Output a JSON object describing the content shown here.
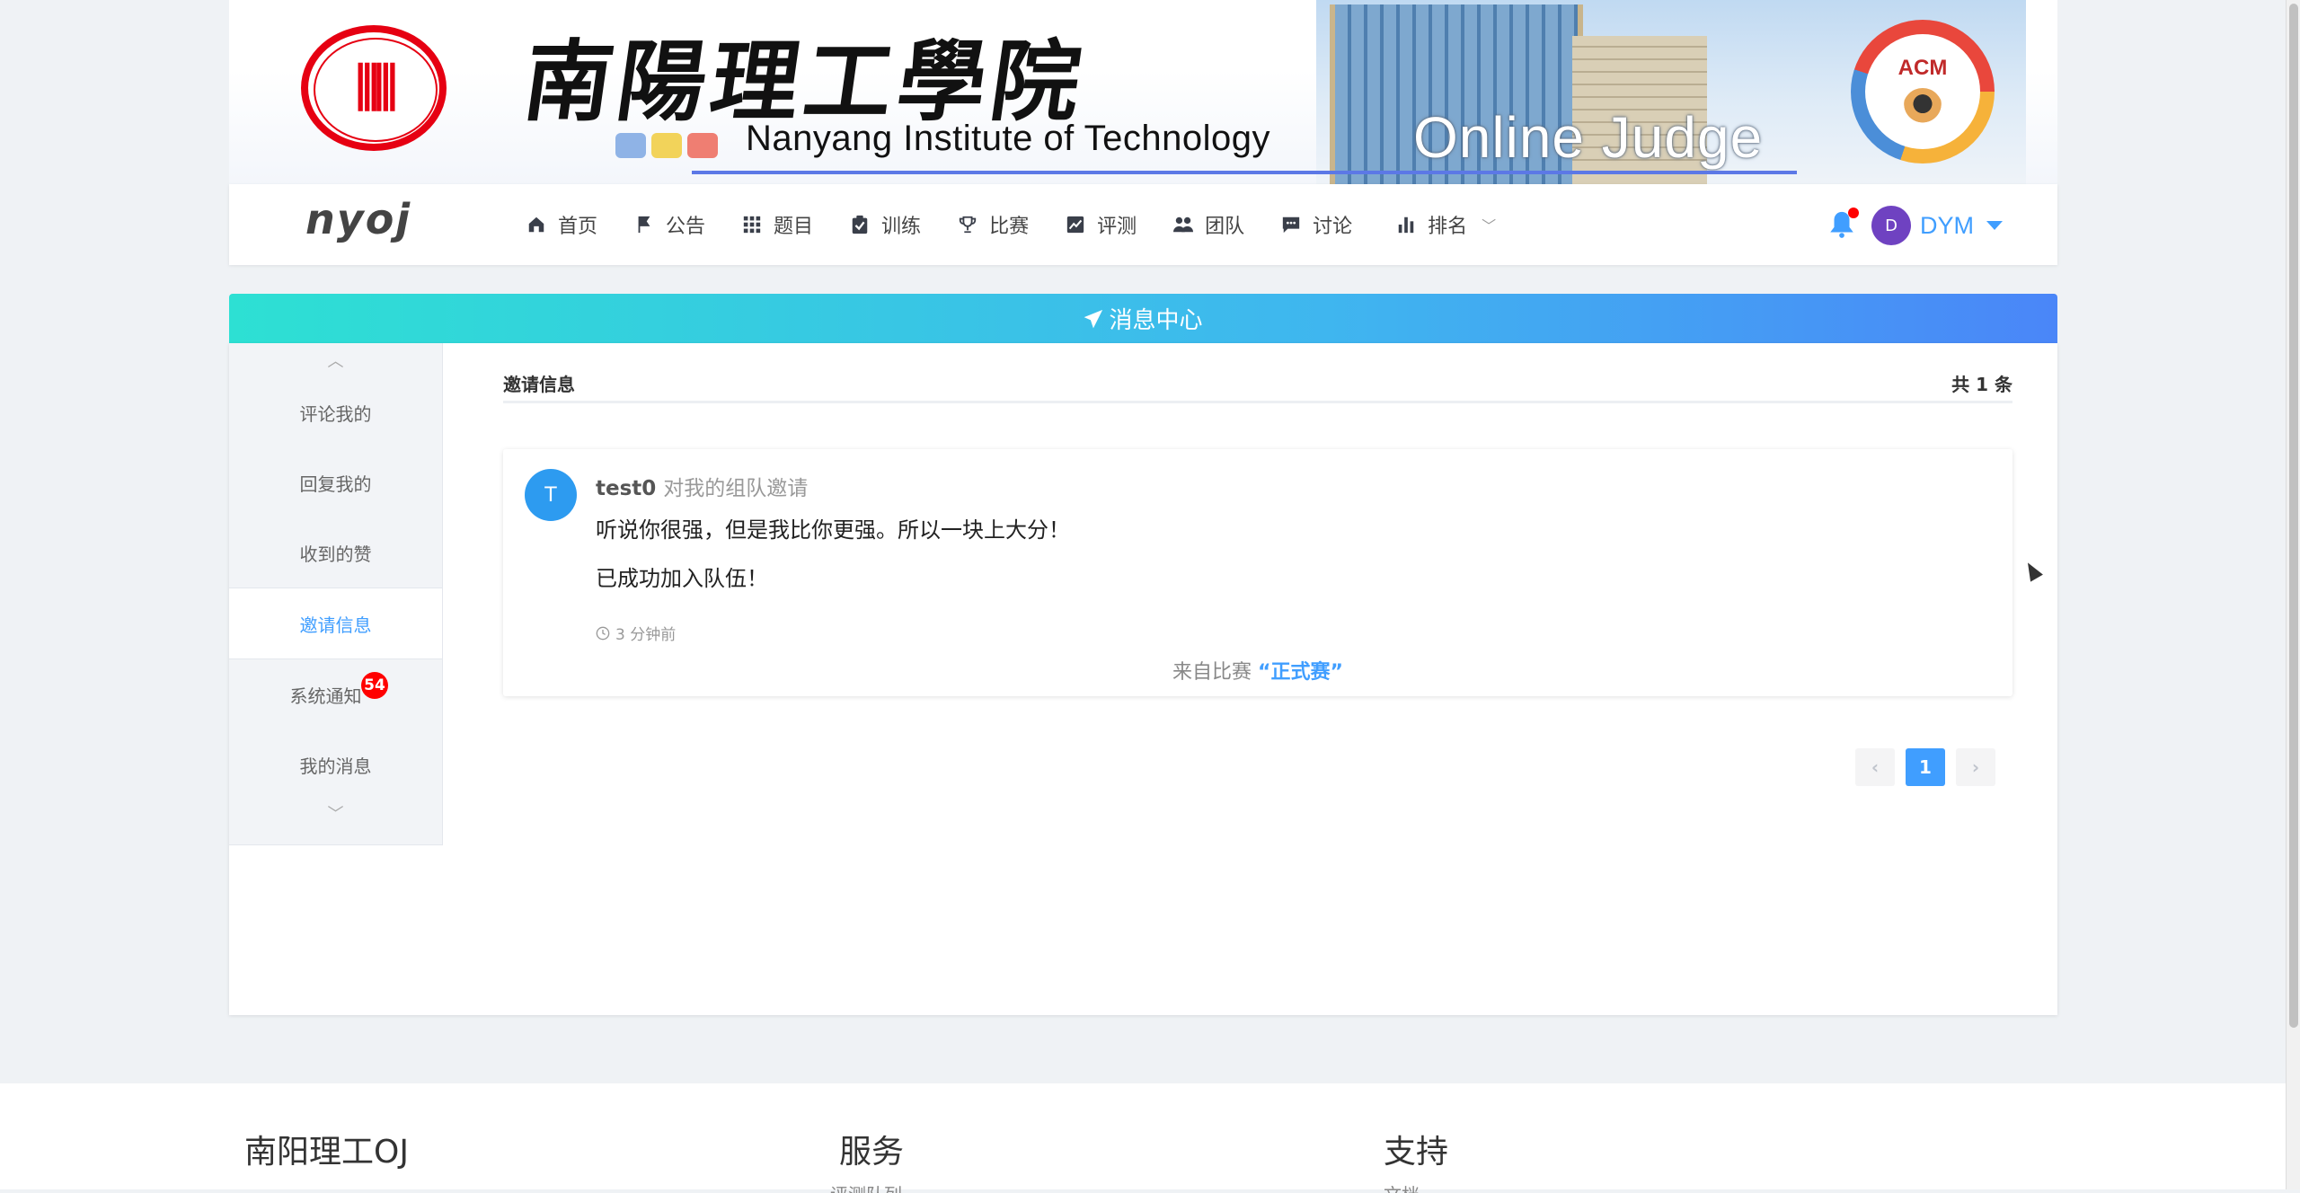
{
  "banner": {
    "school_cn": "南陽理工學院",
    "school_en": "Nanyang Institute of Technology",
    "product": "Online Judge",
    "acm_label": "ACM"
  },
  "nav": {
    "brand": "nyoj",
    "items": [
      {
        "label": "首页",
        "icon": "home-icon"
      },
      {
        "label": "公告",
        "icon": "flag-icon"
      },
      {
        "label": "题目",
        "icon": "grid-icon"
      },
      {
        "label": "训练",
        "icon": "clipboard-icon"
      },
      {
        "label": "比赛",
        "icon": "trophy-icon"
      },
      {
        "label": "评测",
        "icon": "chart-line-icon"
      },
      {
        "label": "团队",
        "icon": "users-icon"
      },
      {
        "label": "讨论",
        "icon": "comment-icon"
      },
      {
        "label": "排名",
        "icon": "bar-chart-icon"
      }
    ],
    "user_initial": "D",
    "username": "DYM"
  },
  "message_center": {
    "title": "消息中心",
    "sidebar": [
      {
        "label": "评论我的"
      },
      {
        "label": "回复我的"
      },
      {
        "label": "收到的赞"
      },
      {
        "label": "邀请信息",
        "active": true
      },
      {
        "label": "系统通知",
        "badge": "54"
      },
      {
        "label": "我的消息"
      }
    ],
    "section_title": "邀请信息",
    "total": "共 1 条",
    "message": {
      "avatar": "T",
      "sender": "test0",
      "action": "对我的组队邀请",
      "text": "听说你很强，但是我比你更强。所以一块上大分！",
      "status": "已成功加入队伍！",
      "time": "3 分钟前",
      "from_prefix": "来自比赛",
      "from_contest": "“正式赛”"
    },
    "pagination": {
      "current": "1",
      "prev": "‹",
      "next": "›"
    }
  },
  "footer": {
    "columns": [
      "南阳理工OJ",
      "服务",
      "支持"
    ],
    "subs": [
      "评测队列",
      "文档"
    ]
  },
  "colors": {
    "primary": "#409eff",
    "header_gradient": [
      "#2de0d3",
      "#4a86f8"
    ],
    "badge": "#ff0000",
    "seal_red": "#e60012"
  }
}
